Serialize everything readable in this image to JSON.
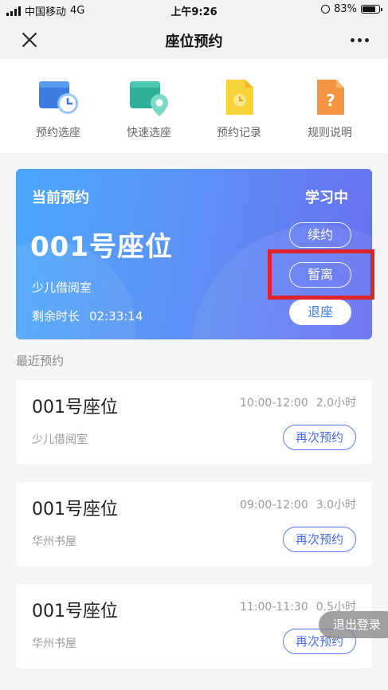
{
  "status_bar": {
    "carrier": "中国移动",
    "network": "4G",
    "time": "上午9:26",
    "battery": "83%"
  },
  "nav": {
    "title": "座位预约"
  },
  "quick_menu": [
    {
      "label": "预约选座",
      "icon": "calendar-clock-icon"
    },
    {
      "label": "快速选座",
      "icon": "location-pin-icon"
    },
    {
      "label": "预约记录",
      "icon": "document-clock-icon"
    },
    {
      "label": "规则说明",
      "icon": "question-document-icon"
    }
  ],
  "current": {
    "header": "当前预约",
    "status": "学习中",
    "seat": "001号座位",
    "room": "少儿借阅室",
    "remain_label": "剩余时长",
    "remain_value": "02:33:14",
    "renew_label": "续约",
    "leave_label": "暂离",
    "checkout_label": "退座"
  },
  "recent": {
    "title": "最近预约",
    "items": [
      {
        "seat": "001号座位",
        "time": "10:00-12:00",
        "duration": "2.0小时",
        "room": "少儿借阅室",
        "button": "再次预约"
      },
      {
        "seat": "001号座位",
        "time": "09:00-12:00",
        "duration": "3.0小时",
        "room": "华州书屋",
        "button": "再次预约"
      },
      {
        "seat": "001号座位",
        "time": "11:00-11:30",
        "duration": "0.5小时",
        "room": "华州书屋",
        "button": "再次预约"
      }
    ]
  },
  "logout_label": "退出登录",
  "colors": {
    "accent": "#4a6cf0",
    "highlight": "#e0232a"
  }
}
